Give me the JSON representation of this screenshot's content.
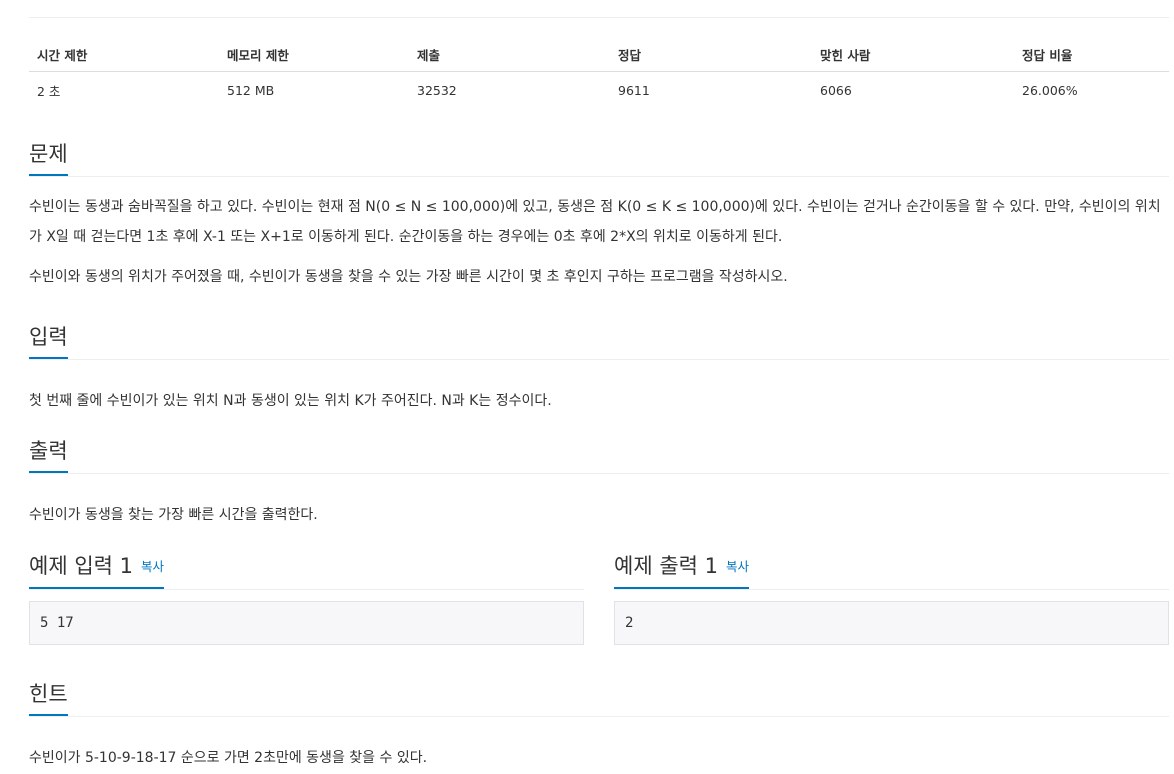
{
  "info_table": {
    "headers": [
      "시간 제한",
      "메모리 제한",
      "제출",
      "정답",
      "맞힌 사람",
      "정답 비율"
    ],
    "values": [
      "2 초",
      "512 MB",
      "32532",
      "9611",
      "6066",
      "26.006%"
    ]
  },
  "problem": {
    "title": "문제",
    "paragraphs": [
      "수빈이는 동생과 숨바꼭질을 하고 있다. 수빈이는 현재 점 N(0 ≤ N ≤ 100,000)에 있고, 동생은 점 K(0 ≤ K ≤ 100,000)에 있다. 수빈이는 걷거나 순간이동을 할 수 있다. 만약, 수빈이의 위치가 X일 때 걷는다면 1초 후에 X-1 또는 X+1로 이동하게 된다. 순간이동을 하는 경우에는 0초 후에 2*X의 위치로 이동하게 된다.",
      "수빈이와 동생의 위치가 주어졌을 때, 수빈이가 동생을 찾을 수 있는 가장 빠른 시간이 몇 초 후인지 구하는 프로그램을 작성하시오."
    ]
  },
  "input": {
    "title": "입력",
    "text": "첫 번째 줄에 수빈이가 있는 위치 N과 동생이 있는 위치 K가 주어진다. N과 K는 정수이다."
  },
  "output": {
    "title": "출력",
    "text": "수빈이가 동생을 찾는 가장 빠른 시간을 출력한다."
  },
  "sample_input": {
    "title": "예제 입력 1",
    "copy_label": "복사",
    "content": "5 17"
  },
  "sample_output": {
    "title": "예제 출력 1",
    "copy_label": "복사",
    "content": "2"
  },
  "hint": {
    "title": "힌트",
    "text": "수빈이가 5-10-9-18-17 순으로 가면 2초만에 동생을 찾을 수 있다."
  },
  "colors": {
    "accent": "#0076c0",
    "text": "#333333",
    "sample_bg": "#f7f7f9"
  }
}
